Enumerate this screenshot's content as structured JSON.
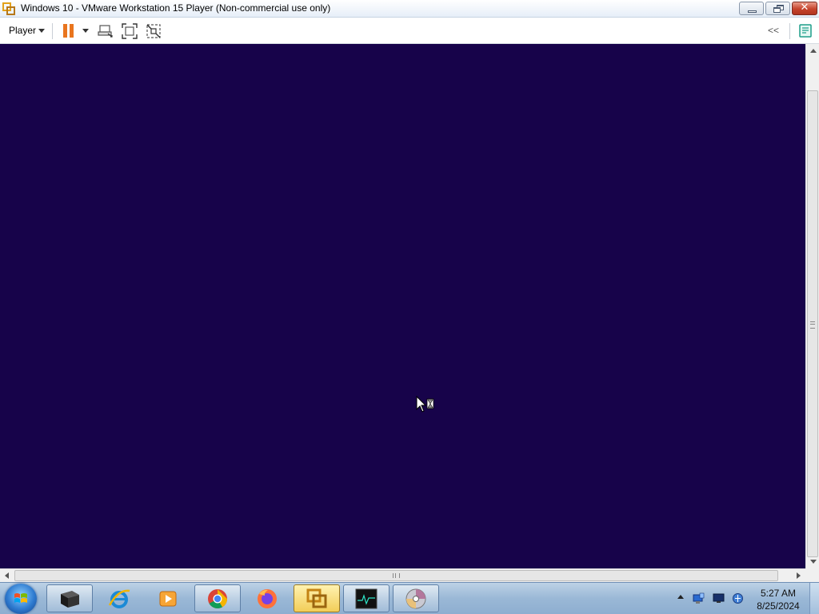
{
  "window": {
    "title": "Windows 10 - VMware Workstation 15 Player (Non-commercial use only)",
    "app_icon": "vmware-player-icon",
    "controls": {
      "minimize": "minimize-icon",
      "maximize": "restore-icon",
      "close_glyph": "✕"
    }
  },
  "toolbar": {
    "player_menu_label": "Player",
    "collapse_label": "<<",
    "icons": [
      "pause-icon",
      "send-ctrl-alt-del-icon",
      "full-screen-icon",
      "unity-icon",
      "message-log-icon"
    ]
  },
  "vm_display": {
    "background_color": "#17034a",
    "cursor": "busy-pointer-icon"
  },
  "taskbar": {
    "start_icon": "windows-start-icon",
    "items": [
      {
        "name": "taskbar-virtualbox",
        "icon": "virtualbox-icon"
      },
      {
        "name": "taskbar-internet-explorer",
        "icon": "internet-explorer-icon"
      },
      {
        "name": "taskbar-media-player",
        "icon": "media-player-icon"
      },
      {
        "name": "taskbar-chrome",
        "icon": "chrome-icon"
      },
      {
        "name": "taskbar-firefox",
        "icon": "firefox-icon"
      },
      {
        "name": "taskbar-vmware-player",
        "icon": "vmware-player-icon",
        "active": true
      },
      {
        "name": "taskbar-monitor",
        "icon": "monitor-app-icon"
      },
      {
        "name": "taskbar-dvd",
        "icon": "dvd-icon"
      }
    ],
    "tray": {
      "icons": [
        "show-hidden-icons-arrow",
        "network-drive-icon",
        "monitor-tray-icon",
        "network-icon"
      ],
      "time": "5:27 AM",
      "date": "8/25/2024"
    }
  },
  "colors": {
    "vm_background": "#17034a",
    "pause_accent": "#e9751e",
    "close_button": "#c6442c",
    "notes_accent": "#1e9e8a"
  }
}
